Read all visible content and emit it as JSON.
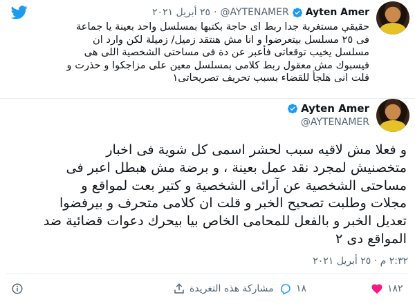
{
  "tweet1": {
    "author_name": "Ayten Amer",
    "handle": "@AYTENAMER",
    "date": "٢٥ أبريل ٢٠٢١",
    "separator": "·",
    "lines": [
      "حقيقي مستغربة جدا ربط اى حاجة بكتبها بمسلسل واحد بعينة يا جماعة",
      "فى ٢٥ مسلسل بيتعرضوا و انا مش هنتقد زميل/ زميلة لكن وارد ان",
      "مسلسل يخيب توقعاتى فأعبر عن دة فى مساحتى الشخصية اللى هى",
      "فيسبوك مش معقول ربط كلامى بمسلسل معين على مزاجكوا و حذرت و",
      "قلت انى هلجأ للقضاء بسبب تحريف تصريحاتى١"
    ]
  },
  "tweet2": {
    "author_name": "Ayten Amer",
    "handle": "@AYTENAMER",
    "lines": [
      "و فعلا مش لاقيه سبب لحشر اسمى كل شوية فى اخبار",
      "متخصنيش لمجرد نقد عمل بعينة ، و برضة مش هبطل اعبر فى",
      "مساحتى الشخصية عن آرائى الشخصية و كتير بعت لمواقع و",
      "مجلات وطلبت تصحيح الخبر و قلت ان كلامى متحرف و بيرفضوا",
      "تعديل الخبر و بالفعل للمحامى الخاص بيا بيحرك دعوات قضائية ضد",
      "المواقع دى ٢"
    ],
    "timestamp": "٢:٣٢ م · ٢٥ أبريل ٢٠٢١"
  },
  "actions": {
    "likes": "١٨٢",
    "replies": "١٨",
    "share_label": "مشاركة هذه التغريدة"
  },
  "colors": {
    "twitter_blue": "#1d9bf0",
    "text": "#0f1419",
    "muted": "#536471",
    "divider": "#e6ecf0"
  },
  "icons": [
    "twitter-bird-icon",
    "verified-badge-icon",
    "heart-icon",
    "reply-icon",
    "share-icon",
    "info-icon"
  ]
}
